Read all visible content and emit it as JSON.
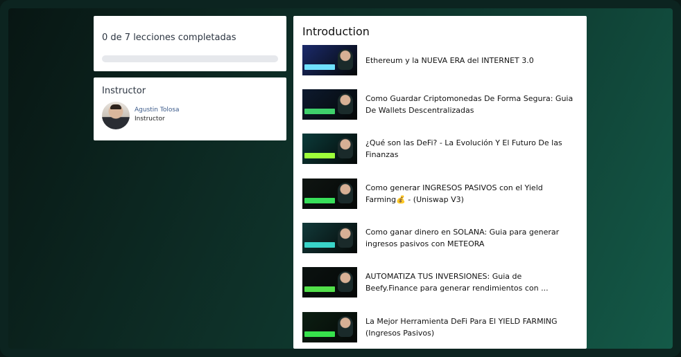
{
  "progress": {
    "label": "0 de 7 lecciones completadas",
    "fraction": 0
  },
  "instructor": {
    "heading": "Instructor",
    "name": "Agustin Tolosa",
    "role": "Instructor"
  },
  "section": {
    "title": "Introduction"
  },
  "lessons": [
    {
      "title": "Ethereum y la NUEVA ERA del INTERNET 3.0",
      "thumb_color": "#1b2a6b",
      "accent": "#6fe0ff"
    },
    {
      "title": "Como Guardar Criptomonedas De Forma Segura: Guia De Wallets Descentralizadas",
      "thumb_color": "#0d1a2f",
      "accent": "#3fd06b"
    },
    {
      "title": "¿Qué son las DeFi? - La Evolución Y El Futuro De las Finanzas",
      "thumb_color": "#0b3b3a",
      "accent": "#9eff3a"
    },
    {
      "title": "Como generar INGRESOS PASIVOS con el Yield Farming💰 - (Uniswap V3)",
      "thumb_color": "#0f1512",
      "accent": "#38e05a"
    },
    {
      "title": "Como ganar dinero en SOLANA: Guia para generar ingresos pasivos con METEORA",
      "thumb_color": "#123a3a",
      "accent": "#39d4c8"
    },
    {
      "title": "AUTOMATIZA TUS INVERSIONES: Guia de Beefy.Finance para generar rendimientos con ...",
      "thumb_color": "#0b1210",
      "accent": "#52e04a"
    },
    {
      "title": "La Mejor Herramienta DeFi Para El YIELD FARMING (Ingresos Pasivos)",
      "thumb_color": "#0c1f12",
      "accent": "#37e24c"
    }
  ]
}
